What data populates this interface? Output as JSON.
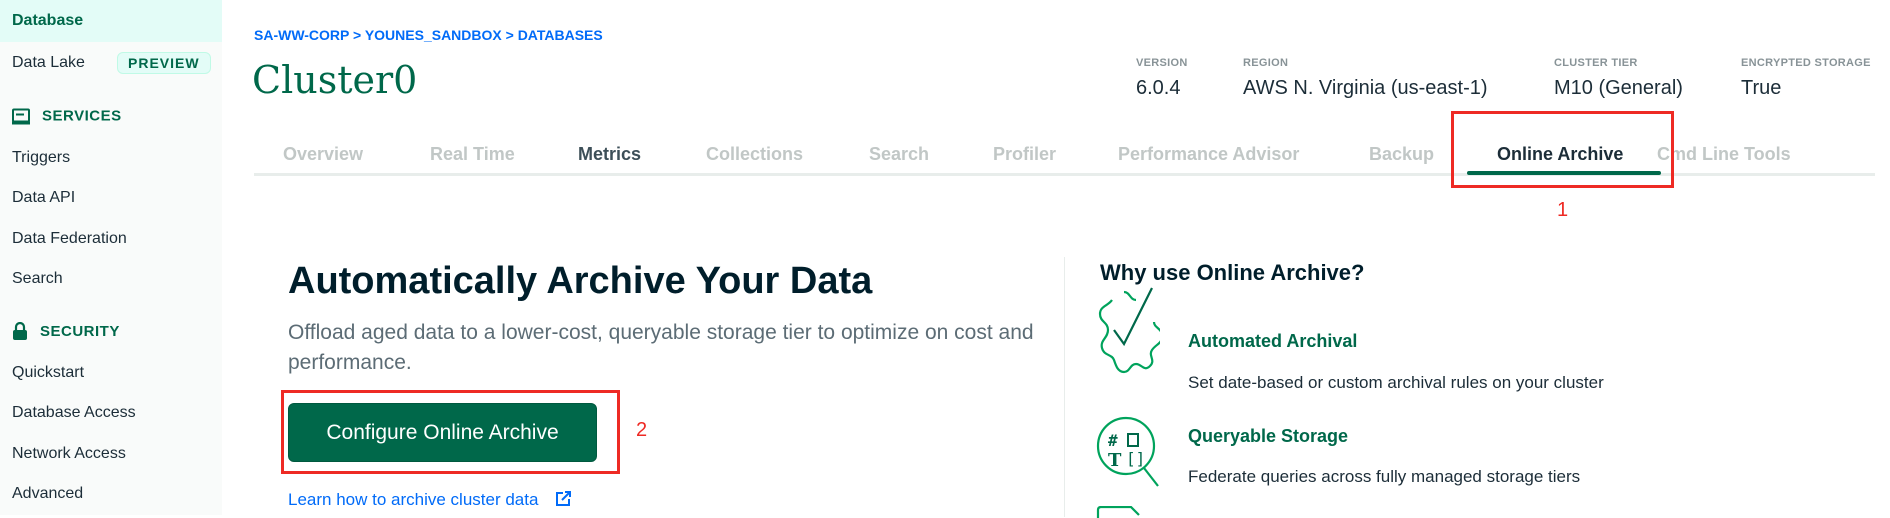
{
  "sidebar": {
    "database": "Database",
    "data_lake": "Data Lake",
    "preview_badge": "PREVIEW",
    "services_header": "SERVICES",
    "services": [
      "Triggers",
      "Data API",
      "Data Federation",
      "Search"
    ],
    "security_header": "SECURITY",
    "security": [
      "Quickstart",
      "Database Access",
      "Network Access",
      "Advanced"
    ]
  },
  "breadcrumb": "SA-WW-CORP > YOUNES_SANDBOX > DATABASES",
  "cluster_name": "Cluster0",
  "meta": [
    {
      "label": "VERSION",
      "value": "6.0.4"
    },
    {
      "label": "REGION",
      "value": "AWS N. Virginia (us-east-1)"
    },
    {
      "label": "CLUSTER TIER",
      "value": "M10 (General)"
    },
    {
      "label": "ENCRYPTED STORAGE",
      "value": "True"
    }
  ],
  "tabs": [
    "Overview",
    "Real Time",
    "Metrics",
    "Collections",
    "Search",
    "Profiler",
    "Performance Advisor",
    "Backup",
    "Online Archive",
    "Cmd Line Tools"
  ],
  "annotations": [
    "1",
    "2"
  ],
  "main": {
    "heading": "Automatically Archive Your Data",
    "description": "Offload aged data to a lower-cost, queryable storage tier to optimize on cost and performance.",
    "configure_button": "Configure Online Archive",
    "learn_link": "Learn how to archive cluster data"
  },
  "why": {
    "heading": "Why use Online Archive?",
    "features": [
      {
        "title": "Automated Archival",
        "desc": "Set date-based or custom archival rules on your cluster"
      },
      {
        "title": "Queryable Storage",
        "desc": "Federate queries across fully managed storage tiers"
      }
    ]
  },
  "colors": {
    "accent": "#00684a",
    "link": "#016bf8",
    "annotation": "#ee2a24"
  }
}
